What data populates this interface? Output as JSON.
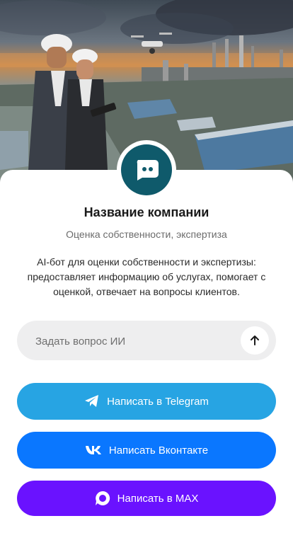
{
  "hero": {
    "image_alt": "industrial-site-photo"
  },
  "company": {
    "name": "Название компании",
    "category": "Оценка собственности, экспертиза",
    "description": "AI-бот для оценки собственности и экспертизы: предоставляет информацию об услугах, помогает с оценкой, отвечает на вопросы клиентов."
  },
  "ask": {
    "placeholder": "Задать вопрос ИИ",
    "send_icon": "arrow-up-icon"
  },
  "buttons": {
    "telegram": {
      "label": "Написать в Telegram",
      "icon": "telegram-icon",
      "color": "#27a4e3"
    },
    "vk": {
      "label": "Написать Вконтакте",
      "icon": "vk-icon",
      "color": "#0a77ff"
    },
    "max": {
      "label": "Написать в MAX",
      "icon": "max-icon",
      "color": "#6a12ff"
    }
  },
  "avatar": {
    "icon": "chat-bot-icon",
    "color": "#0f5a6b"
  }
}
